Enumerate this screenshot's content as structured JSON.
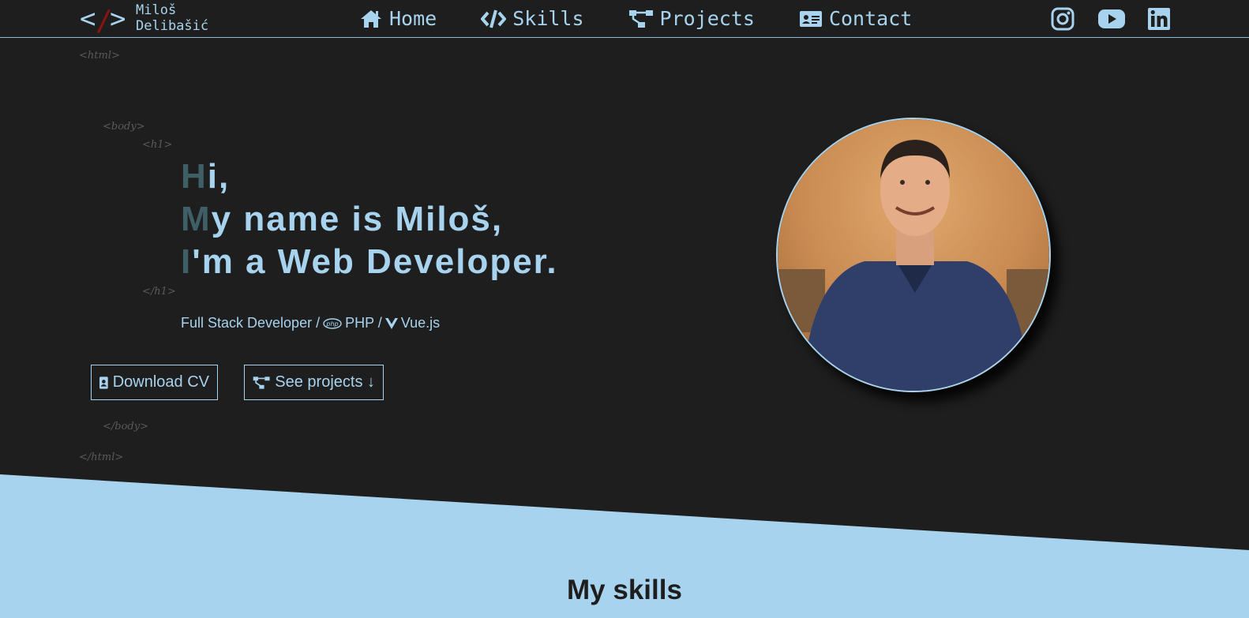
{
  "logo": {
    "line1": "Miloš",
    "line2": "Delibašić",
    "bracket_open": "<",
    "slash": "/",
    "bracket_close": ">"
  },
  "nav": {
    "items": [
      {
        "label": "Home",
        "icon": "home-icon"
      },
      {
        "label": "Skills",
        "icon": "code-icon"
      },
      {
        "label": "Projects",
        "icon": "sitemap-icon"
      },
      {
        "label": "Contact",
        "icon": "id-card-icon"
      }
    ],
    "social": [
      "instagram-icon",
      "youtube-icon",
      "linkedin-icon"
    ]
  },
  "tags": {
    "html_open": "<html>",
    "body_open": "<body>",
    "h1_open": "<h1>",
    "h1_close": "</h1>",
    "body_close": "</body>",
    "html_close": "</html>"
  },
  "hero": {
    "line1_first": "H",
    "line1_rest": "i,",
    "line2_first": "M",
    "line2_rest": "y name is Miloš,",
    "line3_first": "I",
    "line3_rest": "'m a Web Developer.",
    "subtitle_part1": "Full Stack Developer /",
    "subtitle_php": "PHP /",
    "subtitle_vue": "Vue.js",
    "php_icon_text": "php"
  },
  "buttons": {
    "download_cv": "Download CV",
    "see_projects": "See projects ↓"
  },
  "skills": {
    "title": "My skills"
  },
  "colors": {
    "background": "#1e1e1e",
    "accent": "#a7d3ee",
    "logo_slash": "#8a1414",
    "tag_gray": "#5a5a5a"
  }
}
